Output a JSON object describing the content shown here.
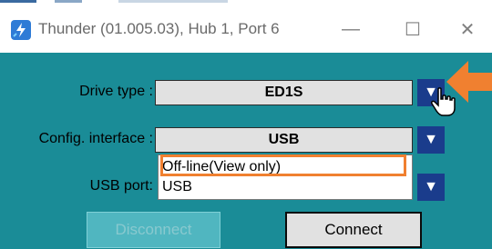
{
  "window": {
    "title": "Thunder (01.005.03), Hub 1, Port 6",
    "minimize_glyph": "—",
    "maximize_glyph": "☐",
    "close_glyph": "✕"
  },
  "form": {
    "drive_type_label": "Drive type :",
    "drive_type_value": "ED1S",
    "config_interface_label": "Config. interface :",
    "config_interface_value": "USB",
    "usb_port_label": "USB port:",
    "dropdown_glyph": "▼"
  },
  "config_dropdown": {
    "options": [
      "Off-line(View only)",
      "USB"
    ]
  },
  "buttons": {
    "disconnect": "Disconnect",
    "connect": "Connect"
  },
  "colors": {
    "panel": "#1a8c97",
    "accent_arrow": "#f08030",
    "dropdown_button": "#1a3c8c"
  },
  "icons": {
    "app": "thunder-app-icon",
    "pointer": "hand-cursor-icon",
    "annotation": "orange-arrow-icon"
  }
}
